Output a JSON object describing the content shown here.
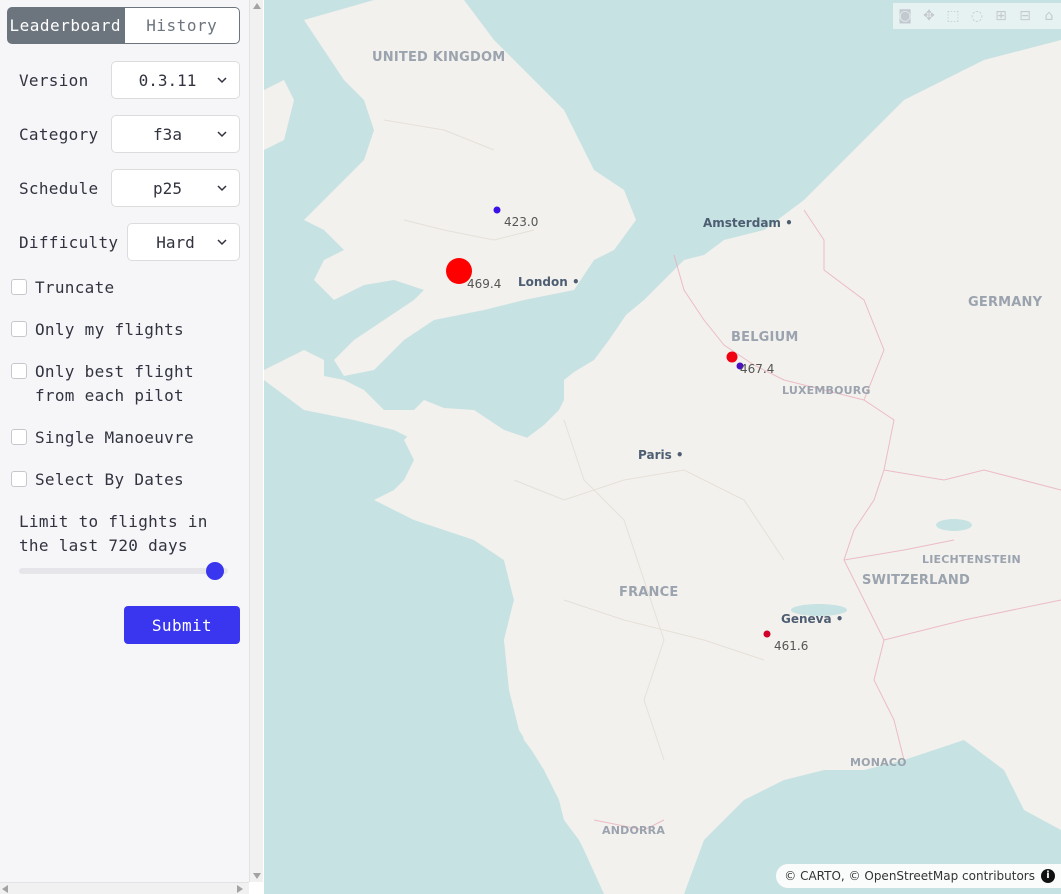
{
  "tabs": {
    "leaderboard": "Leaderboard",
    "history": "History"
  },
  "filters": {
    "version": {
      "label": "Version",
      "value": "0.3.11"
    },
    "category": {
      "label": "Category",
      "value": "f3a"
    },
    "schedule": {
      "label": "Schedule",
      "value": "p25"
    },
    "difficulty": {
      "label": "Difficulty",
      "value": "Hard"
    }
  },
  "checkboxes": {
    "truncate": "Truncate",
    "only_my_flights": "Only my flights",
    "only_best_1": "Only best flight",
    "only_best_2": "from each pilot",
    "single_manoeuvre": "Single Manoeuvre",
    "select_by_dates": "Select By Dates"
  },
  "limit": {
    "line1": "Limit to flights in",
    "line2": "the last 720 days",
    "days": 720
  },
  "submit_label": "Submit",
  "map": {
    "countries": {
      "uk": "UNITED KINGDOM",
      "belgium": "BELGIUM",
      "germany": "GERMANY",
      "luxembourg": "LUXEMBOURG",
      "france": "FRANCE",
      "switzerland": "SWITZERLAND",
      "liechtenstein": "LIECHTENSTEIN",
      "monaco": "MONACO",
      "andorra": "ANDORRA"
    },
    "cities": {
      "amsterdam": "Amsterdam",
      "london": "London",
      "paris": "Paris",
      "geneva": "Geneva"
    },
    "scores": {
      "s1": "423.0",
      "s2": "469.4",
      "s3": "467.4",
      "s4": "461.6"
    },
    "attribution": "© CARTO, © OpenStreetMap contributors",
    "info": "i",
    "colors": {
      "water": "#c7e2e2",
      "land": "#f3f1ed",
      "red": "#ff0000",
      "blue": "#3a10e5"
    }
  }
}
